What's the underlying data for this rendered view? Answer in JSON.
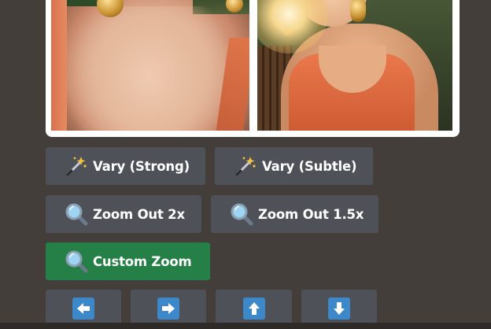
{
  "image_grid": {
    "tiles": [
      {
        "name": "left-image"
      },
      {
        "name": "right-image"
      }
    ]
  },
  "buttons": {
    "vary_strong": {
      "label": "Vary (Strong)",
      "icon": "magic-wand-icon"
    },
    "vary_subtle": {
      "label": "Vary (Subtle)",
      "icon": "magic-wand-icon"
    },
    "zoom_out_2x": {
      "label": "Zoom Out 2x",
      "icon": "magnifier-icon"
    },
    "zoom_out_1_5x": {
      "label": "Zoom Out 1.5x",
      "icon": "magnifier-icon"
    },
    "custom_zoom": {
      "label": "Custom Zoom",
      "icon": "magnifier-icon"
    },
    "pan": [
      {
        "direction": "left",
        "icon": "arrow-left-icon"
      },
      {
        "direction": "right",
        "icon": "arrow-right-icon"
      },
      {
        "direction": "up",
        "icon": "arrow-up-icon"
      },
      {
        "direction": "down",
        "icon": "arrow-down-icon"
      }
    ]
  },
  "colors": {
    "background": "#433e39",
    "button": "#4e5158",
    "primary_button": "#248046",
    "arrow_blue": "#3d88c9"
  }
}
